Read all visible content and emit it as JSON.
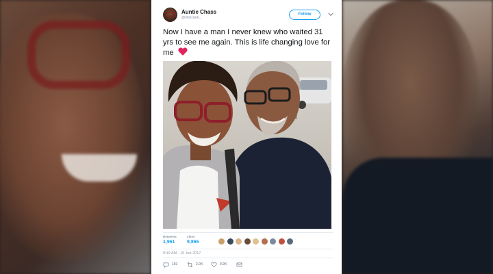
{
  "tweet": {
    "author_name": "Auntie Chass",
    "author_handle": "@MsClark_",
    "follow_label": "Follow",
    "text": "Now I have a man I never knew who waited 31 yrs to see me again. This is life changing love for me",
    "retweets_label": "Retweets",
    "retweets_count": "1,961",
    "likes_label": "Likes",
    "likes_count": "9,866",
    "timestamp": "9:19 AM - 15 Jun 2017",
    "reply_count": "191",
    "retweet_action_count": "2.0K",
    "like_action_count": "9.9K"
  },
  "colors": {
    "accent": "#1da1f2",
    "heart": "#e0245e",
    "muted": "#8a98a5"
  },
  "likers": [
    "#c9a06a",
    "#3a4a5a",
    "#d9b48a",
    "#6a4a3a",
    "#e0c090",
    "#b07050",
    "#7a8a9a",
    "#c05040",
    "#5a6a7a"
  ],
  "icons": [
    "chevron-down-icon",
    "heart-emoji-icon",
    "reply-icon",
    "retweet-icon",
    "like-icon",
    "message-icon"
  ]
}
